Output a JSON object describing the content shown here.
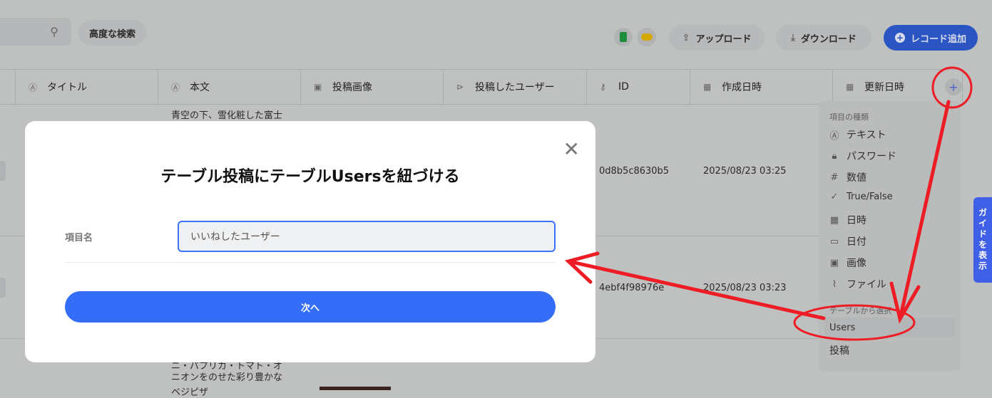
{
  "toolbar": {
    "search_icon": "search-icon",
    "advanced_search": "高度な検索",
    "upload": "アップロード",
    "download": "ダウンロード",
    "add_record": "レコード追加"
  },
  "columns": [
    {
      "label": "タイトル",
      "icon": "text-icon"
    },
    {
      "label": "本文",
      "icon": "text-icon"
    },
    {
      "label": "投稿画像",
      "icon": "image-icon"
    },
    {
      "label": "投稿したユーザー",
      "icon": "relation-icon"
    },
    {
      "label": "ID",
      "icon": "key-icon"
    },
    {
      "label": "作成日時",
      "icon": "datetime-icon"
    },
    {
      "label": "更新日時",
      "icon": "datetime-icon"
    }
  ],
  "rows": [
    {
      "body": "青空の下、雪化粧した富士",
      "id": "0d8b5c8630b5",
      "created": "2025/08/23 03:25"
    },
    {
      "body": "",
      "id": "4ebf4f98976e",
      "created": "2025/08/23 03:23"
    },
    {
      "body_line1": "ニ・パプリカ・トマト・オ",
      "body_line2": "ニオンをのせた彩り豊かな",
      "body_line3": "ベジピザ"
    }
  ],
  "menu": {
    "section1": "項目の種類",
    "types": [
      "テキスト",
      "パスワード",
      "数値",
      "True/False",
      "日時",
      "日付",
      "画像",
      "ファイル"
    ],
    "section2": "テーブルから選択",
    "tables": [
      "Users",
      "投稿"
    ]
  },
  "guide": "ガイドを表示",
  "modal": {
    "title": "テーブル投稿にテーブルUsersを紐づける",
    "field_label": "項目名",
    "field_value": "いいねしたユーザー",
    "next": "次へ"
  },
  "colors": {
    "accent": "#346df7",
    "annotation": "#ee1c24"
  }
}
